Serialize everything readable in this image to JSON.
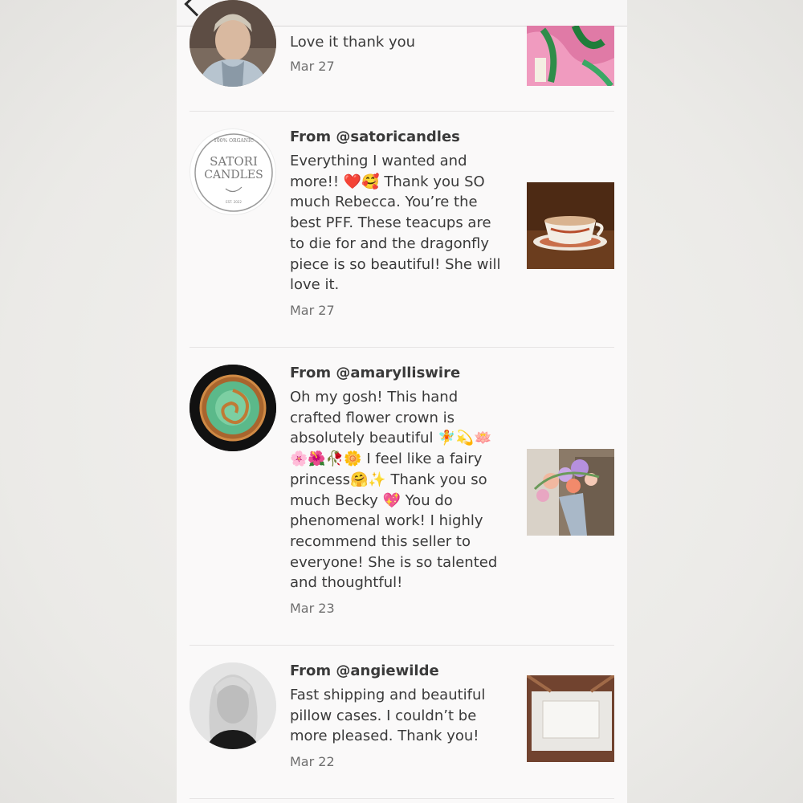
{
  "reviews": [
    {
      "from": "",
      "message": "Love it thank you",
      "date": "Mar 27",
      "avatar_icon": "person-photo",
      "photo_icon": "pink-green-fabric"
    },
    {
      "from": "From @satoricandles",
      "message": "Everything I wanted and more!! ❤️🥰 Thank you SO much Rebecca. You’re the best PFF. These teacups are to die for and the dragonfly piece is so beautiful! She will love it.",
      "date": "Mar 27",
      "avatar_logo": {
        "top": "100% ORGANIC",
        "line1": "SATORI",
        "line2": "CANDLES",
        "bottom": "EST. 2022"
      },
      "photo_icon": "teacup"
    },
    {
      "from": "From @amarylliswire",
      "message": "Oh my gosh! This hand crafted flower crown is absolutely beautiful 🧚💫🪷 🌸🌺🥀🌼 I feel like a fairy princess🤗✨ Thank you so much Becky 💖 You do phenomenal work! I highly recommend this seller to everyone! She is so talented and thoughtful!",
      "date": "Mar 23",
      "avatar_icon": "wire-pendant",
      "photo_icon": "flower-crown"
    },
    {
      "from": "From @angiewilde",
      "message": "Fast shipping and beautiful pillow cases. I couldn’t be more pleased. Thank you!",
      "date": "Mar 22",
      "avatar_icon": "portrait-photo",
      "photo_icon": "pillowcase-box"
    }
  ],
  "colors": {
    "text": "#3a3a3a",
    "date": "#6f6f6f",
    "divider": "#e6e4e4",
    "background": "#faf9f9"
  }
}
